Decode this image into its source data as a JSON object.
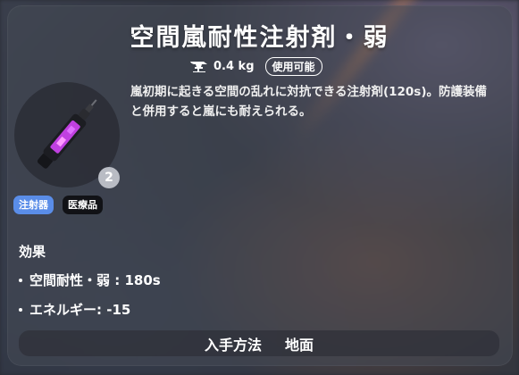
{
  "item": {
    "name": "空間嵐耐性注射剤・弱",
    "weight": "0.4 kg",
    "usable_badge": "使用可能",
    "description": "嵐初期に起きる空間の乱れに対抗できる注射剤(120s)。防護装備と併用すると嵐にも耐えられる。",
    "count": "2",
    "icon": "injector-syringe-icon",
    "tags": [
      "注射器",
      "医療品"
    ]
  },
  "effects": {
    "title": "効果",
    "items": [
      "空間耐性・弱 : 180s",
      "エネルギー: -15"
    ]
  },
  "acquisition": {
    "label": "入手方法",
    "value": "地面"
  },
  "colors": {
    "tag_injector": "#5a8de8",
    "tag_medical": "#111216",
    "liquid": "#c040e0"
  }
}
